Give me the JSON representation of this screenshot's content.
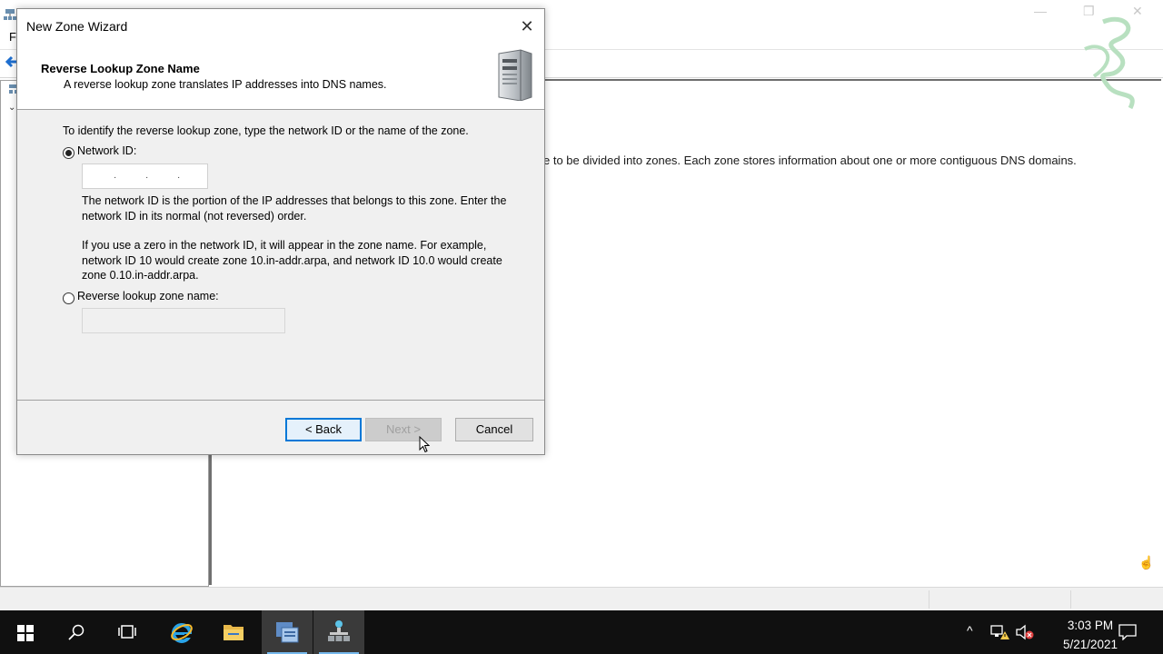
{
  "background_window": {
    "menu_letter": "F",
    "content_description": "e to be divided into zones. Each zone stores information about one or more contiguous DNS domains."
  },
  "dialog": {
    "title": "New Zone Wizard",
    "close_glyph": "✕",
    "heading": "Reverse Lookup Zone Name",
    "subheading": "A reverse lookup zone translates IP addresses into DNS names.",
    "instruction": "To identify the reverse lookup zone, type the network ID or the name of the zone.",
    "network_id": {
      "label": "Network ID:",
      "selected": true,
      "value_dots": ".  .  ."
    },
    "network_id_help_1": "The network ID is the portion of the IP addresses that belongs to this zone. Enter the network ID in its normal (not reversed) order.",
    "network_id_help_2": "If you use a zero in the network ID, it will appear in the zone name. For example, network ID 10 would create zone 10.in-addr.arpa, and network ID 10.0 would create zone 0.10.in-addr.arpa.",
    "reverse_zone_name": {
      "label": "Reverse lookup zone name:",
      "selected": false,
      "value": ""
    },
    "buttons": {
      "back": "< Back",
      "next": "Next >",
      "cancel": "Cancel"
    }
  },
  "taskbar": {
    "items": [
      "start-icon",
      "search-icon",
      "task-view-icon",
      "internet-explorer-icon",
      "file-explorer-icon",
      "server-manager-icon",
      "dns-manager-icon"
    ],
    "time": "3:03 PM",
    "date": "5/21/2021",
    "accent_color": "#76b9ed"
  }
}
